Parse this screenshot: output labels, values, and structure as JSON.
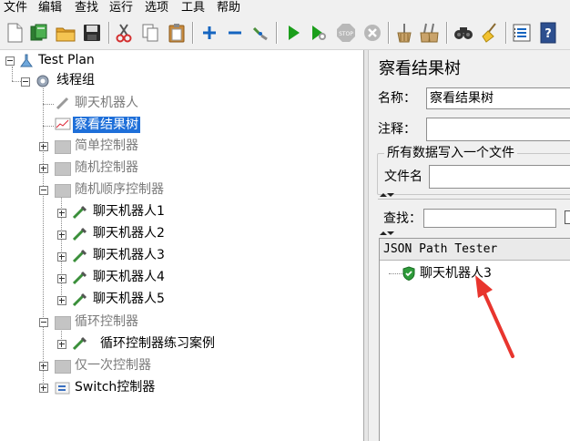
{
  "menu": [
    "文件",
    "编辑",
    "查找",
    "运行",
    "选项",
    "工具",
    "帮助"
  ],
  "toolbar_icons": [
    "new-icon",
    "templates-icon",
    "open-icon",
    "save-icon",
    "cut-icon",
    "copy-icon",
    "paste-icon",
    "expand-icon",
    "collapse-icon",
    "toggle-icon",
    "start-icon",
    "start-no-pause-icon",
    "stop-icon",
    "shutdown-icon",
    "clear-icon",
    "clear-all-icon",
    "search-icon",
    "reset-search-icon",
    "function-helper-icon",
    "help-icon"
  ],
  "tree": {
    "test_plan": "Test Plan",
    "thread_group": "线程组",
    "chat_robot": "聊天机器人",
    "view_results_tree": "察看结果树",
    "simple_controller": "简单控制器",
    "random_controller": "随机控制器",
    "random_order_controller": "随机顺序控制器",
    "samplers": [
      "聊天机器人1",
      "聊天机器人2",
      "聊天机器人3",
      "聊天机器人4",
      "聊天机器人5"
    ],
    "loop_controller": "循环控制器",
    "loop_case": "循环控制器练习案例",
    "once_only_controller": "仅一次控制器",
    "switch_controller": "Switch控制器"
  },
  "right_panel": {
    "title": "察看结果树",
    "name_label": "名称：",
    "name_value": "察看结果树",
    "comment_label": "注释：",
    "comment_value": "",
    "file_group_label": "所有数据写入一个文件",
    "filename_label": "文件名",
    "filename_value": "",
    "search_label": "查找：",
    "search_value": "",
    "renderer": "JSON Path Tester",
    "result_item": "聊天机器人3"
  },
  "colors": {
    "selection": "#1e6fd9",
    "annotation_arrow": "#e8352e",
    "success_shield": "#2e9b3a"
  }
}
